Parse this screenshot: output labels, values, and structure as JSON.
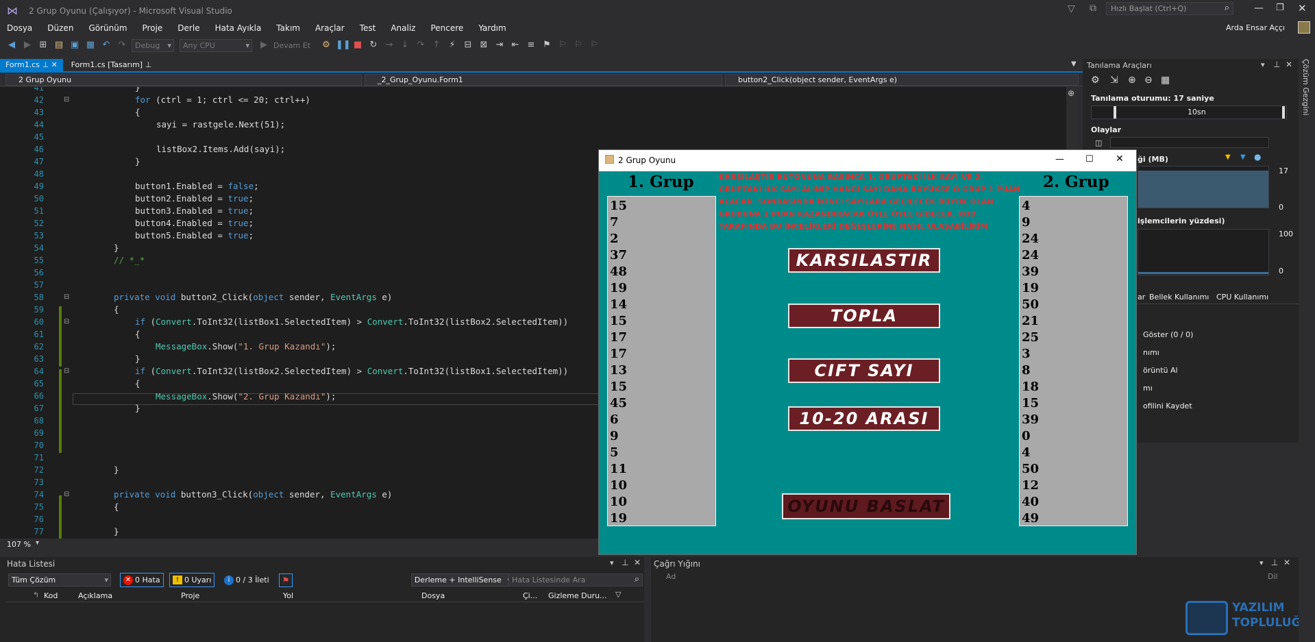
{
  "window": {
    "title": "2 Grup Oyunu (Çalışıyor) - Microsoft Visual Studio",
    "search_placeholder": "Hızlı Başlat (Ctrl+Q)",
    "user": "Arda Ensar Aççı"
  },
  "menu": [
    "Dosya",
    "Düzen",
    "Görünüm",
    "Proje",
    "Derle",
    "Hata Ayıkla",
    "Takım",
    "Araçlar",
    "Test",
    "Analiz",
    "Pencere",
    "Yardım"
  ],
  "toolbar": {
    "config": "Debug",
    "platform": "Any CPU",
    "continue": "Devam Et"
  },
  "tabs": [
    {
      "label": "Form1.cs"
    },
    {
      "label": "Form1.cs [Tasarım]"
    }
  ],
  "navbar": {
    "project": "2 Grup Oyunu",
    "class": "_2_Grup_Oyunu.Form1",
    "member": "button2_Click(object sender, EventArgs e)"
  },
  "code": {
    "line_numbers": [
      "41",
      "42",
      "43",
      "44",
      "45",
      "46",
      "47",
      "48",
      "49",
      "50",
      "51",
      "52",
      "53",
      "54",
      "55",
      "56",
      "57",
      "58",
      "59",
      "60",
      "61",
      "62",
      "63",
      "64",
      "65",
      "66",
      "67",
      "68",
      "69",
      "70",
      "71",
      "72",
      "73",
      "74",
      "75",
      "76",
      "77"
    ],
    "l41": "}",
    "l42a": "for",
    "l42b": " (ctrl = 1; ctrl <= 20; ctrl++)",
    "l43": "{",
    "l44": "sayi = rastgele.Next(51);",
    "l46": "listBox2.Items.Add(sayi);",
    "l47": "}",
    "l49a": "button1.Enabled = ",
    "l49b": "false",
    "l49c": ";",
    "l50a": "button2.Enabled = ",
    "l50b": "true",
    "l50c": ";",
    "l51a": "button3.Enabled = ",
    "l51b": "true",
    "l51c": ";",
    "l52a": "button4.Enabled = ",
    "l52b": "true",
    "l52c": ";",
    "l53a": "button5.Enabled = ",
    "l53b": "true",
    "l53c": ";",
    "l54": "}",
    "l55": "// *_*",
    "l58a": "private",
    "l58b": "void",
    "l58c": " button2_Click(",
    "l58d": "object",
    "l58e": " sender, ",
    "l58f": "EventArgs",
    "l58g": " e)",
    "l59": "{",
    "l60a": "if",
    "l60b": " (",
    "l60c": "Convert",
    "l60d": ".ToInt32(listBox1.SelectedItem) > ",
    "l60e": "Convert",
    "l60f": ".ToInt32(listBox2.SelectedItem))",
    "l61": "{",
    "l62a": "MessageBox",
    "l62b": ".Show(",
    "l62c": "\"1. Grup Kazandı\"",
    "l62d": ");",
    "l63": "}",
    "l64a": "if",
    "l64b": " (",
    "l64c": "Convert",
    "l64d": ".ToInt32(listBox2.SelectedItem) > ",
    "l64e": "Convert",
    "l64f": ".ToInt32(listBox1.SelectedItem))",
    "l65": "{",
    "l66a": "MessageBox",
    "l66b": ".Show(",
    "l66c": "\"2. Grup Kazandı\"",
    "l66d": ");",
    "l67": "}",
    "l72": "}",
    "l74a": "private",
    "l74b": "void",
    "l74c": " button3_Click(",
    "l74d": "object",
    "l74e": " sender, ",
    "l74f": "EventArgs",
    "l74g": " e)",
    "l75": "{",
    "l77": "}"
  },
  "zoom": "107 %",
  "error_list": {
    "title": "Hata Listesi",
    "scope": "Tüm Çözüm",
    "errors": "0 Hata",
    "warnings": "0 Uyarı",
    "messages": "0 / 3 İleti",
    "build_filter": "Derleme + IntelliSense",
    "search_placeholder": "Hata Listesinde Ara",
    "columns": [
      "Kod",
      "Açıklama",
      "Proje",
      "Yol",
      "Dosya",
      "Çi...",
      "Gizleme Duru..."
    ]
  },
  "call_stack": {
    "title": "Çağrı Yığını",
    "col_name": "Ad",
    "col_lang": "Dil"
  },
  "diagnostics": {
    "title": "Tanılama Araçları",
    "session": "Tanılama oturumu: 17 saniye",
    "timeline_label": "10sn",
    "events": "Olaylar",
    "memory": "ği (MB)",
    "mem_max": "17",
    "mem_min": "0",
    "cpu": "işlemcilerin yüzdesi)",
    "cpu_max": "100",
    "cpu_min": "0",
    "tabs": [
      "ar",
      "Bellek Kullanımı",
      "CPU Kullanımı"
    ],
    "items": [
      "Göster (0 / 0)",
      "nımı",
      "örüntü Al",
      "mı",
      "ofilini Kaydet"
    ]
  },
  "right_strip": "Çözüm Gezgini",
  "watermark": {
    "line1": "YAZILIM",
    "line2": "TOPLULUĞU"
  },
  "game": {
    "title": "2 Grup Oyunu",
    "group1": "1. Grup",
    "group2": "2. Grup",
    "instructions": "KARŞILAŞTIR BUTONUNA BASINCA 1. GRUPTAKİ İLK SAYI VE 2. GRUPTAKİ İLK SAYI ALINIP HANGİ SAYI DAHA BÜYÜKSE O GRUP 1 PUAN ALACAK. SONRASINDA İKİNCİ SAYILARA GEÇİLECEK BÜYÜK OLAN GRUBUNA 1 PUAN KAZANDIRACAK ÖYLE ÖYLE GİDECEK. KOD TARAFINDA BU İNCELİKLERİ DEĞEŞLERİNE NASIL ULAŞABİLİRİM",
    "list1": [
      "15",
      "7",
      "2",
      "37",
      "48",
      "19",
      "14",
      "15",
      "17",
      "17",
      "13",
      "15",
      "45",
      "6",
      "9",
      "5",
      "11",
      "10",
      "10",
      "19"
    ],
    "list2": [
      "4",
      "9",
      "24",
      "24",
      "39",
      "19",
      "50",
      "21",
      "25",
      "3",
      "8",
      "18",
      "15",
      "39",
      "0",
      "4",
      "50",
      "12",
      "40",
      "49"
    ],
    "buttons": {
      "compare": "KARSILASTIR",
      "sum": "TOPLA",
      "even": "CIFT SAYI",
      "range": "10-20 ARASI",
      "start": "OYUNU BASLAT"
    }
  }
}
